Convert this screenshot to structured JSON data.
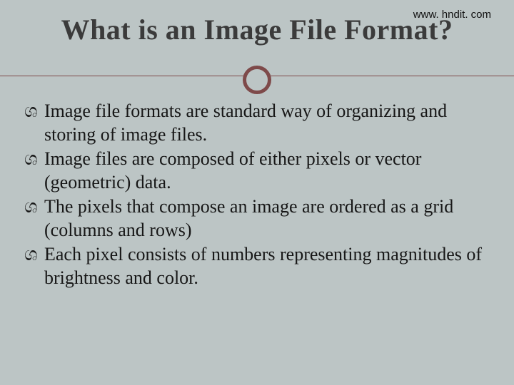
{
  "url": "www. hndit. com",
  "title": "What is an Image File Format?",
  "bullet_glyph": "ශ",
  "bullets": [
    "Image file formats are standard way of organizing and storing of image files.",
    "Image files are composed of either pixels or vector (geometric) data.",
    "The pixels that compose an image are ordered as a grid (columns and rows)",
    "Each pixel consists of numbers representing magnitudes of brightness and color."
  ]
}
